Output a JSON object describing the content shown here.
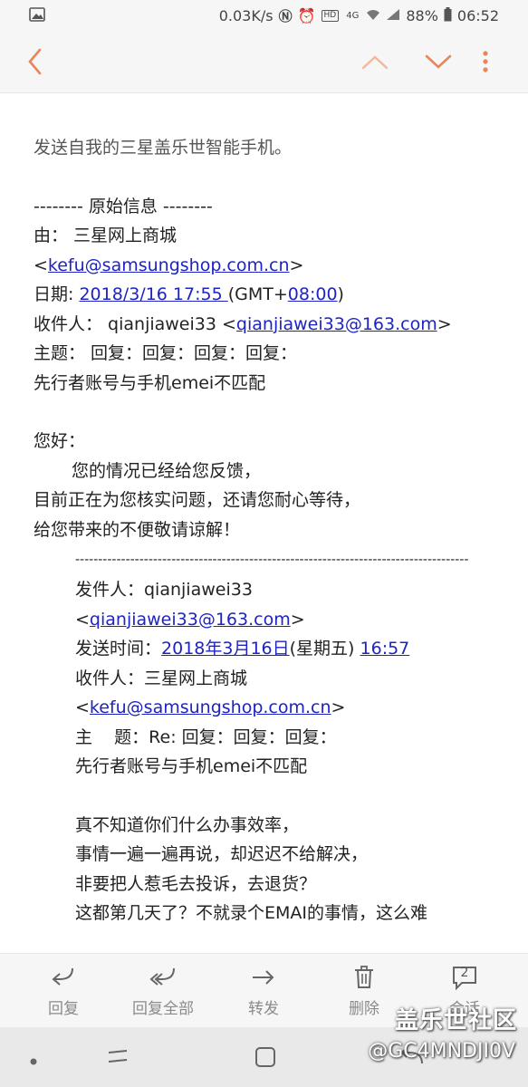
{
  "status_bar": {
    "speed": "0.03K/s",
    "network_badge": "HD",
    "signal_badge": "4G",
    "battery": "88%",
    "time": "06:52"
  },
  "app_bar": {
    "back_icon": "chevron-left-icon",
    "up_icon": "chevron-up-icon",
    "down_icon": "chevron-down-icon",
    "more_icon": "more-vertical-icon",
    "accent_color": "#e8865a"
  },
  "email": {
    "intro": "发送自我的三星盖乐世智能手机。",
    "original_header": "-------- 原始信息 --------",
    "from_label": "由： 三星网上商城",
    "from_email_prefix": "<",
    "from_email": "kefu@samsungshop.com.cn",
    "from_email_suffix": ">",
    "date_label": "日期: ",
    "date_value": "2018/3/16 17:55 ",
    "date_tz_prefix": "(GMT+",
    "date_tz_value": "08:00",
    "date_tz_suffix": ")",
    "to_label": "收件人： qianjiawei33 <",
    "to_email": "qianjiawei33@163.com",
    "to_suffix": ">",
    "subject_line1": "主题： 回复：回复：回复：回复：",
    "subject_line2": "先行者账号与手机emei不匹配",
    "body": [
      "您好：",
      "您的情况已经给您反馈，",
      "目前正在为您核实问题，还请您耐心等待，",
      "给您带来的不便敬请谅解！"
    ],
    "separator": "------------------------------------------------------------------------------------------",
    "quoted": {
      "sender_label": "发件人：qianjiawei33",
      "sender_email_prefix": "<",
      "sender_email": "qianjiawei33@163.com",
      "sender_email_suffix": ">",
      "sent_time_label": "发送时间：",
      "sent_date": "2018年3月16日",
      "sent_weekday": "(星期五) ",
      "sent_time": "16:57",
      "recipient_label": "收件人：三星网上商城",
      "recipient_email_prefix": "<",
      "recipient_email": "kefu@samsungshop.com.cn",
      "recipient_email_suffix": ">",
      "subject_line1": "主    题：Re: 回复：回复：回复：",
      "subject_line2": "先行者账号与手机emei不匹配",
      "body": [
        "真不知道你们什么办事效率，",
        "事情一遍一遍再说，却迟迟不给解决，",
        "非要把人惹毛去投诉，去退货？",
        "这都第几天了？不就录个EMAI的事情，这么难"
      ]
    }
  },
  "actions": {
    "reply": "回复",
    "reply_all": "回复全部",
    "forward": "转发",
    "delete": "删除",
    "conversation": "会话",
    "conversation_count": "2"
  },
  "watermark": {
    "line1": "盖乐世社区",
    "line2": "@GC4MNDJI0V"
  }
}
